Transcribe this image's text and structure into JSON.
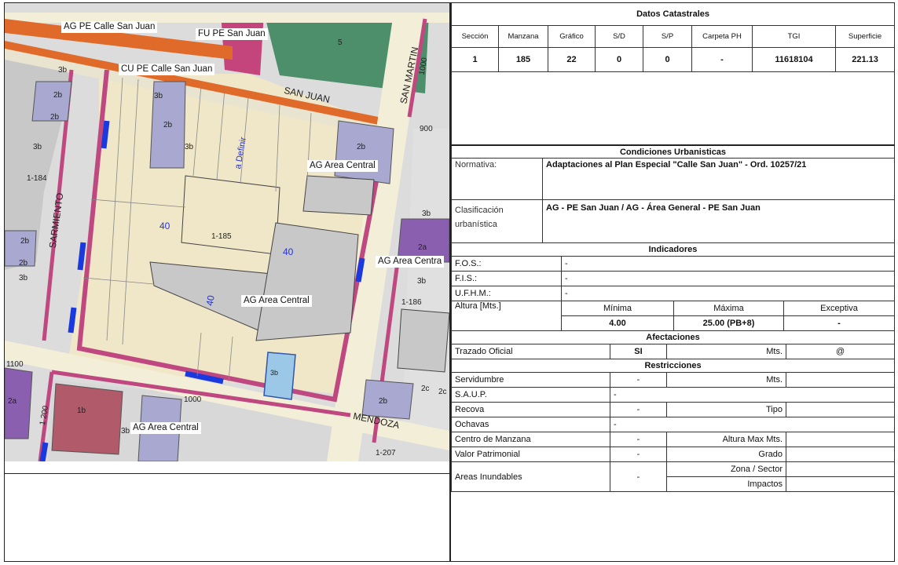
{
  "map": {
    "labels": {
      "ag_calle_sanjuan": "AG PE Calle San Juan",
      "fu_pe_sanjuan": "FU PE San Juan",
      "cu_pe_calle_sanjuan": "CU PE Calle San Juan",
      "ag_area_central_1": "AG Area Central",
      "ag_area_central_2": "AG Area Centra",
      "ag_area_central_3": "AG Area Central",
      "ag_area_central_4": "AG Area Central"
    },
    "streets": {
      "san_juan": "SAN JUAN",
      "san_martin": "SAN MARTIN",
      "sarmiento": "SARMIENTO",
      "mendoza": "MENDOZA",
      "a_definir": "a Definir"
    },
    "numbers": {
      "n1000a": "1000",
      "n900": "900",
      "n1100": "1100",
      "n1200": "1 200",
      "n1000b": "1000",
      "b40a": "40",
      "b40b": "40",
      "b40c": "40",
      "p1184": "1-184",
      "p1185": "1-185",
      "p1186": "1-186",
      "p1207": "1-207",
      "z5": "5",
      "z3b1": "3b",
      "z2b1": "2b",
      "z2b2": "2b",
      "z3b2": "3b",
      "z3b3": "3b",
      "z2b3": "2b",
      "z3b4": "3b",
      "z2b4": "2b",
      "z2b5": "2b",
      "z2b6": "2b",
      "z3b5": "3b",
      "z3b6": "3b",
      "z2a1": "2a",
      "z3b7": "3b",
      "z2a2": "2a",
      "z1b": "1b",
      "z3b8": "3b",
      "z2b7": "2b",
      "z2c1": "2c",
      "z2c2": "2c",
      "z3b9": "3b"
    }
  },
  "catastro": {
    "title": "Datos Catastrales",
    "headers": [
      "Sección",
      "Manzana",
      "Gráfico",
      "S/D",
      "S/P",
      "Carpeta PH",
      "TGI",
      "Superficie"
    ],
    "values": [
      "1",
      "185",
      "22",
      "0",
      "0",
      "-",
      "11618104",
      "221.13"
    ]
  },
  "urbanisticas": {
    "title": "Condiciones Urbanisticas",
    "normativa_label": "Normativa:",
    "normativa_value": "Adaptaciones al Plan Especial \"Calle San Juan\" - Ord. 10257/21",
    "clasificacion_label_1": "Clasificación",
    "clasificacion_label_2": "urbanística",
    "clasificacion_value": "AG - PE San Juan / AG - Área General - PE San Juan"
  },
  "indicadores": {
    "title": "Indicadores",
    "fos_label": "F.O.S.:",
    "fos_value": "-",
    "fis_label": "F.I.S.:",
    "fis_value": "-",
    "ufhm_label": "U.F.H.M.:",
    "ufhm_value": "-",
    "altura_label": "Altura [Mts.]",
    "minima_label": "Mínima",
    "minima_value": "4.00",
    "maxima_label": "Máxima",
    "maxima_value": "25.00 (PB+8)",
    "excepcional_label": "Exceptiva",
    "excepcional_value": "-"
  },
  "afectaciones": {
    "title": "Afectaciones",
    "trazado_label": "Trazado Oficial",
    "trazado_value": "SI",
    "mts_label": "Mts.",
    "mts_value": "@"
  },
  "restricciones": {
    "title": "Restricciones",
    "servidumbre_label": "Servidumbre",
    "servidumbre_value": "-",
    "servidumbre_mts_label": "Mts.",
    "saup_label": "S.A.U.P.",
    "saup_value": "-",
    "recova_label": "Recova",
    "recova_value": "-",
    "recova_tipo_label": "Tipo",
    "ochavas_label": "Ochavas",
    "ochavas_value": "-",
    "centro_label": "Centro de Manzana",
    "centro_value": "-",
    "centro_altura_label": "Altura Max Mts.",
    "valor_label": "Valor Patrimonial",
    "valor_value": "-",
    "valor_grado_label": "Grado",
    "areas_label": "Areas Inundables",
    "areas_value": "-",
    "zona_label": "Zona / Sector",
    "impactos_label": "Impactos"
  }
}
